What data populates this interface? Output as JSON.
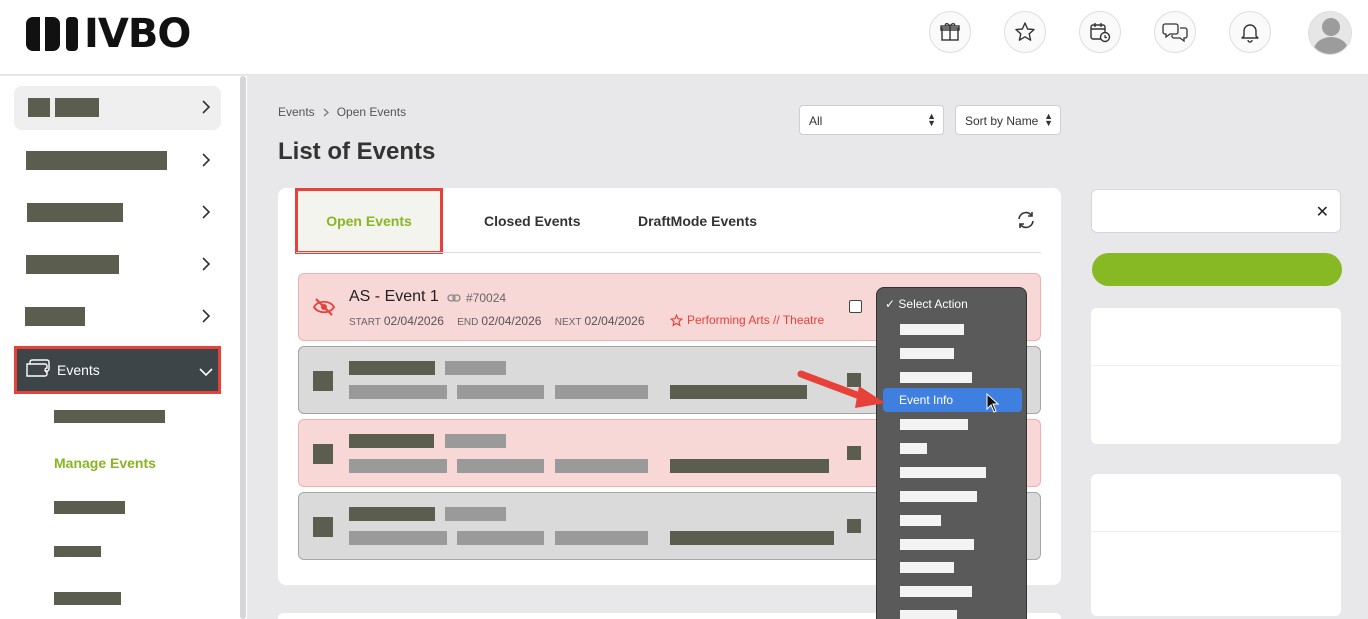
{
  "header": {
    "logo_text": "IVBO",
    "icons": [
      "gift-box-icon",
      "star-icon",
      "calendar-clock-icon",
      "chat-bubbles-icon",
      "bell-icon",
      "user-avatar-icon"
    ]
  },
  "sidebar": {
    "events_label": "Events",
    "manage_events_label": "Manage Events"
  },
  "breadcrumb": {
    "root": "Events",
    "current": "Open Events"
  },
  "page_title": "List of Events",
  "filters": {
    "status_value": "All",
    "sort_value": "Sort by Name"
  },
  "tabs": {
    "open": "Open Events",
    "closed": "Closed Events",
    "draft": "DraftMode Events"
  },
  "event": {
    "title": "AS - Event 1",
    "id": "#70024",
    "start_label": "START",
    "start_date": "02/04/2026",
    "end_label": "END",
    "end_date": "02/04/2026",
    "next_label": "NEXT",
    "next_date": "02/04/2026",
    "category": "Performing Arts // Theatre"
  },
  "action_menu": {
    "selected": "✓ Select Action",
    "highlighted": "Event Info"
  },
  "search": {
    "clear": "✕"
  },
  "colors": {
    "accent_green": "#86b923",
    "annotation_red": "#e8413a",
    "menu_highlight": "#3f7fe0"
  }
}
